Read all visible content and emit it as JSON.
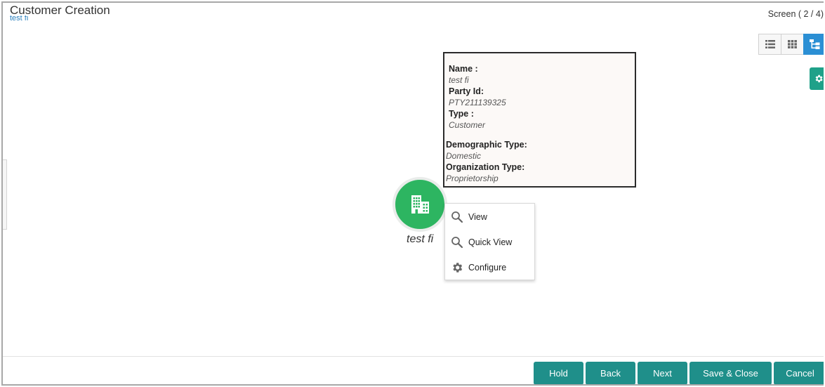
{
  "header": {
    "title": "Customer Creation",
    "subtitle": "test fi",
    "screen_indicator": "Screen ( 2 / 4)"
  },
  "view_toggle": {
    "icons": [
      "list-view-icon",
      "grid-view-icon",
      "hierarchy-view-icon"
    ],
    "active": "hierarchy-view-icon"
  },
  "settings_icon": "gear-icon",
  "tooltip": {
    "name_label": "Name :",
    "name_value": "test fi",
    "party_id_label": "Party Id:",
    "party_id_value": "PTY211139325",
    "type_label": "Type :",
    "type_value": "Customer",
    "demographic_label": "Demographic Type:",
    "demographic_value": "Domestic",
    "org_type_label": "Organization Type:",
    "org_type_value": "Proprietorship"
  },
  "node": {
    "label": "test fi",
    "icon": "building-icon",
    "color": "#2db561"
  },
  "context_menu": {
    "items": [
      {
        "label": "View",
        "icon": "search-icon"
      },
      {
        "label": "Quick View",
        "icon": "search-icon"
      },
      {
        "label": "Configure",
        "icon": "gear-icon"
      }
    ]
  },
  "footer": {
    "buttons": [
      "Hold",
      "Back",
      "Next",
      "Save & Close",
      "Cancel"
    ],
    "button_color": "#1f8f8a"
  }
}
